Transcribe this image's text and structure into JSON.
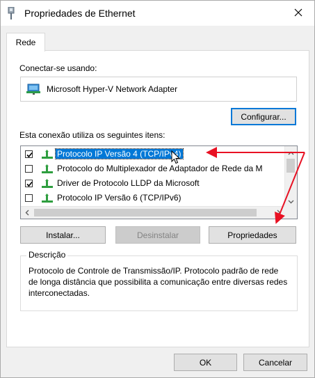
{
  "window": {
    "title": "Propriedades de Ethernet",
    "close_label": "✕"
  },
  "tabs": [
    {
      "label": "Rede",
      "active": true
    }
  ],
  "connect": {
    "label": "Conectar-se usando:",
    "adapter_name": "Microsoft Hyper-V Network Adapter",
    "configure_label": "Configurar..."
  },
  "items": {
    "label": "Esta conexão utiliza os seguintes itens:",
    "list": [
      {
        "label": "Protocolo IP Versão 4 (TCP/IPv4)",
        "checked": true,
        "selected": true
      },
      {
        "label": "Protocolo do Multiplexador de Adaptador de Rede da M",
        "checked": false,
        "selected": false
      },
      {
        "label": "Driver de Protocolo LLDP da Microsoft",
        "checked": true,
        "selected": false
      },
      {
        "label": "Protocolo IP Versão 6 (TCP/IPv6)",
        "checked": false,
        "selected": false
      }
    ]
  },
  "buttons": {
    "install": "Instalar...",
    "uninstall": "Desinstalar",
    "properties": "Propriedades",
    "ok": "OK",
    "cancel": "Cancelar"
  },
  "description": {
    "legend": "Descrição",
    "text": "Protocolo de Controle de Transmissão/IP. Protocolo padrão de rede de longa distância que possibilita a comunicação entre diversas redes interconectadas."
  },
  "colors": {
    "accent": "#0078d7",
    "annotation_arrow": "#e81123"
  },
  "icons": {
    "app": "ethernet-adapter-icon",
    "adapter": "network-adapter-icon",
    "protocol": "network-protocol-icon"
  }
}
